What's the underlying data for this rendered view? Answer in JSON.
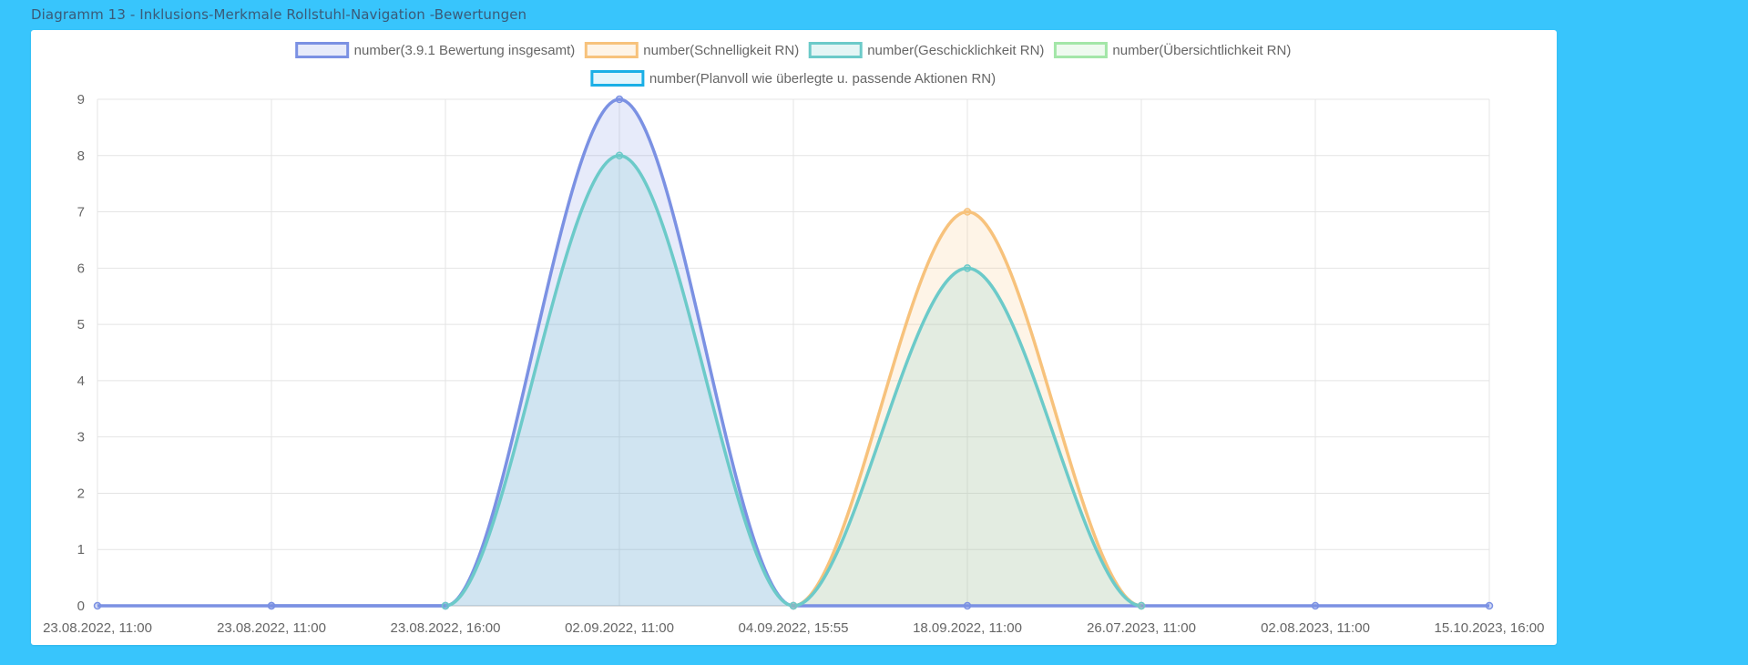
{
  "page": {
    "title": "Diagramm 13 - Inklusions-Merkmale Rollstuhl-Navigation -Bewertungen"
  },
  "chart_data": {
    "type": "area",
    "categories": [
      "23.08.2022, 11:00",
      "23.08.2022, 11:00",
      "23.08.2022, 16:00",
      "02.09.2022, 11:00",
      "04.09.2022, 15:55",
      "18.09.2022, 11:00",
      "26.07.2023, 11:00",
      "02.08.2023, 11:00",
      "15.10.2023, 16:00"
    ],
    "ylim": [
      0,
      9
    ],
    "yticks": [
      "0",
      "1",
      "2",
      "3",
      "4",
      "5",
      "6",
      "7",
      "8",
      "9"
    ],
    "grid": true,
    "legend_position": "top",
    "series": [
      {
        "name": "number(3.9.1 Bewertung insgesamt)",
        "color": "#7b91e3",
        "fill": "rgba(123,145,227,0.18)",
        "values": [
          null,
          0,
          0,
          9,
          0,
          null,
          null,
          null,
          null
        ]
      },
      {
        "name": "number(Schnelligkeit RN)",
        "color": "#f7c27c",
        "fill": "rgba(247,194,124,0.18)",
        "values": [
          null,
          null,
          null,
          null,
          0,
          7,
          0,
          null,
          null
        ]
      },
      {
        "name": "number(Geschicklichkeit RN)",
        "color": "#6ccac9",
        "fill": "rgba(108,202,201,0.18)",
        "values": [
          null,
          null,
          0,
          8,
          0,
          6,
          0,
          null,
          null
        ]
      },
      {
        "name": "number(Übersichtlichkeit RN)",
        "color": "#a3e6a8",
        "fill": "rgba(163,230,168,0.18)",
        "values": [
          null,
          null,
          null,
          null,
          null,
          null,
          null,
          null,
          null
        ]
      },
      {
        "name": "number(Planvoll wie überlegte u. passende Aktionen RN)",
        "color": "#1aafe6",
        "fill": "rgba(26,175,230,0.12)",
        "values": [
          null,
          null,
          null,
          null,
          null,
          null,
          null,
          null,
          null
        ]
      }
    ],
    "baseline_series": {
      "color": "#7b91e3",
      "values": [
        0,
        0,
        0,
        null,
        0,
        0,
        0,
        0,
        0
      ]
    }
  }
}
